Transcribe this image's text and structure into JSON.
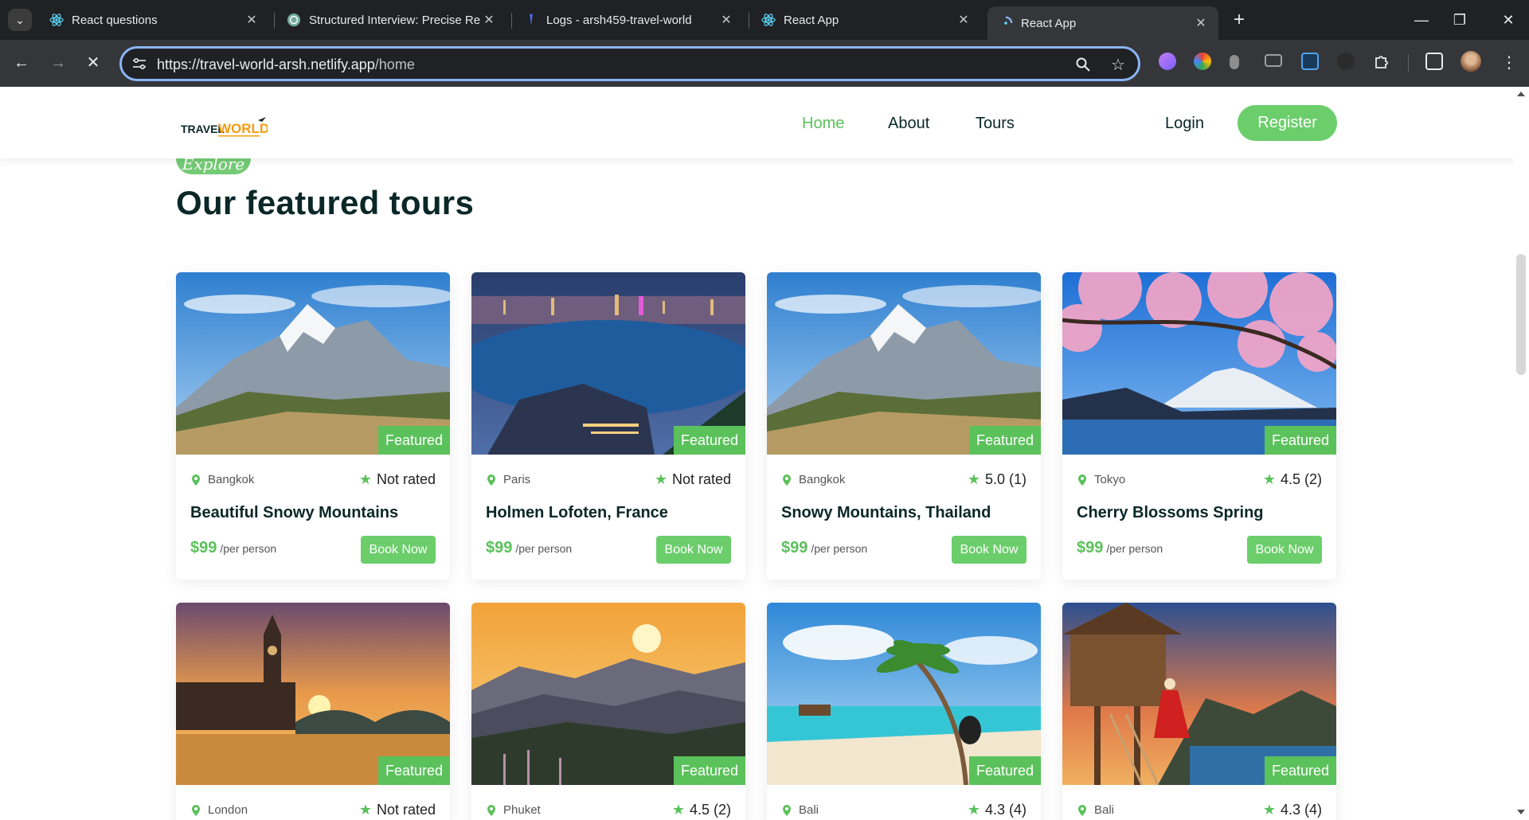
{
  "browser": {
    "tabs": [
      {
        "title": "React questions",
        "favicon": "react-icon"
      },
      {
        "title": "Structured Interview: Precise Re",
        "favicon": "chatgpt-icon"
      },
      {
        "title": "Logs - arsh459-travel-world",
        "favicon": "render-icon"
      },
      {
        "title": "React App",
        "favicon": "react-icon"
      },
      {
        "title": "React App",
        "favicon": "react-loading-icon"
      }
    ],
    "url_scheme": "https://",
    "url_host": "travel-world-arsh.netlify.app",
    "url_path": "/home"
  },
  "site": {
    "nav": {
      "home": "Home",
      "about": "About",
      "tours": "Tours"
    },
    "login": "Login",
    "register": "Register",
    "explore": "Explore",
    "section_title": "Our featured tours",
    "accent_color": "#5bc15b",
    "dark_color": "#0b2727"
  },
  "tours": [
    {
      "city": "Bangkok",
      "rating": "Not rated",
      "title": "Beautiful Snowy Mountains",
      "price": "$99",
      "per": "/per person",
      "book": "Book Now",
      "badge": "Featured",
      "scene": "mountain"
    },
    {
      "city": "Paris",
      "rating": "Not rated",
      "title": "Holmen Lofoten, France",
      "price": "$99",
      "per": "/per person",
      "book": "Book Now",
      "badge": "Featured",
      "scene": "night-city"
    },
    {
      "city": "Bangkok",
      "rating": "5.0 (1)",
      "title": "Snowy Mountains, Thailand",
      "price": "$99",
      "per": "/per person",
      "book": "Book Now",
      "badge": "Featured",
      "scene": "mountain"
    },
    {
      "city": "Tokyo",
      "rating": "4.5 (2)",
      "title": "Cherry Blossoms Spring",
      "price": "$99",
      "per": "/per person",
      "book": "Book Now",
      "badge": "Featured",
      "scene": "cherry"
    },
    {
      "city": "London",
      "rating": "Not rated",
      "title": "",
      "price": "",
      "per": "",
      "book": "",
      "badge": "Featured",
      "scene": "london"
    },
    {
      "city": "Phuket",
      "rating": "4.5 (2)",
      "title": "",
      "price": "",
      "per": "",
      "book": "",
      "badge": "Featured",
      "scene": "sunset-hills"
    },
    {
      "city": "Bali",
      "rating": "4.3 (4)",
      "title": "",
      "price": "",
      "per": "",
      "book": "",
      "badge": "Featured",
      "scene": "beach"
    },
    {
      "city": "Bali",
      "rating": "4.3 (4)",
      "title": "",
      "price": "",
      "per": "",
      "book": "",
      "badge": "Featured",
      "scene": "treehouse"
    }
  ]
}
